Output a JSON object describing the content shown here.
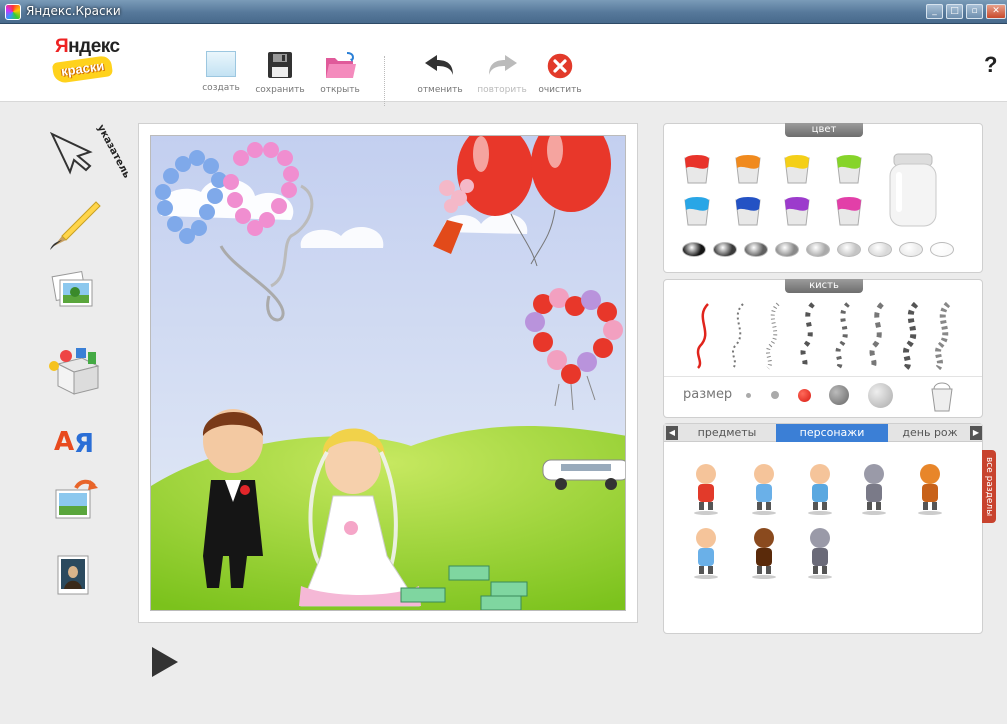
{
  "window": {
    "title": "Яндекс.Краски",
    "minimize": "_",
    "maximize": "□",
    "close": "✕"
  },
  "logo": {
    "top": "Яндекс",
    "bottom": "краски"
  },
  "toolbar": {
    "create_label": "создать",
    "save_label": "сохранить",
    "open_label": "открыть",
    "undo_label": "отменить",
    "redo_label": "повторить",
    "clear_label": "очистить",
    "help_label": "?"
  },
  "left_tools": {
    "pointer_label": "указатель"
  },
  "color_panel": {
    "title": "цвет",
    "buckets": [
      "#e8332a",
      "#f08a1e",
      "#f4cf18",
      "#86d42a",
      "#29a6e6",
      "#2452c4",
      "#9c3bcc",
      "#e23fa8"
    ],
    "shades": [
      "#141414",
      "#3a3a3a",
      "#606060",
      "#8a8a8a",
      "#aaaaaa",
      "#c4c4c4",
      "#d9d9d9",
      "#ebebeb",
      "#fafafa"
    ]
  },
  "brush_panel": {
    "title": "кисть",
    "size_label": "размер"
  },
  "objects_panel": {
    "tabs": [
      "предметы",
      "персонажи",
      "день рож"
    ],
    "active_tab": "персонажи",
    "side_tab": "все разделы",
    "characters": [
      "boy-character",
      "girl-character",
      "kid-character",
      "gray-cat-character",
      "orange-cat-character",
      "small-boy-character",
      "dog-character",
      "kitten-character"
    ]
  }
}
